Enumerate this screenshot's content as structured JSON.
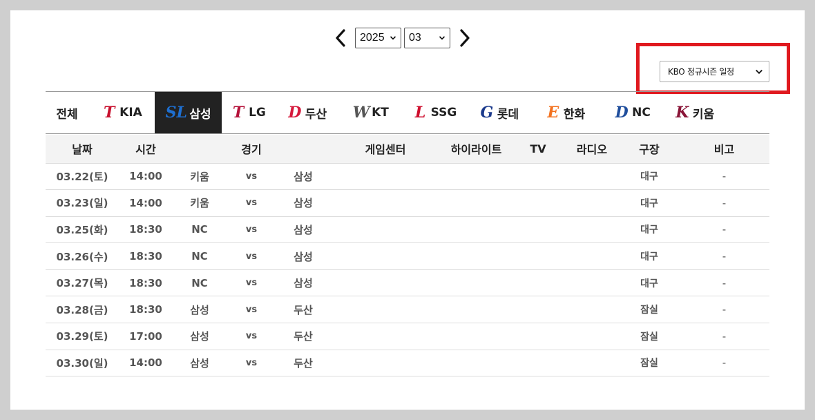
{
  "date_nav": {
    "year": "2025",
    "month": "03"
  },
  "season_select": {
    "value": "KBO 정규시즌 일정"
  },
  "teams": [
    {
      "label": "전체",
      "logo": "",
      "logo_color": "",
      "active": false
    },
    {
      "label": "KIA",
      "logo": "T",
      "logo_color": "#c8102e",
      "active": false
    },
    {
      "label": "삼성",
      "logo": "SL",
      "logo_color": "#1e6fd0",
      "active": true
    },
    {
      "label": "LG",
      "logo": "T",
      "logo_color": "#b5123a",
      "active": false
    },
    {
      "label": "두산",
      "logo": "D",
      "logo_color": "#d61a3c",
      "active": false
    },
    {
      "label": "KT",
      "logo": "W",
      "logo_color": "#555555",
      "active": false
    },
    {
      "label": "SSG",
      "logo": "L",
      "logo_color": "#ce0e2d",
      "active": false
    },
    {
      "label": "롯데",
      "logo": "G",
      "logo_color": "#1b3a8c",
      "active": false
    },
    {
      "label": "한화",
      "logo": "E",
      "logo_color": "#f37321",
      "active": false
    },
    {
      "label": "NC",
      "logo": "D",
      "logo_color": "#1f4e9c",
      "active": false
    },
    {
      "label": "키움",
      "logo": "K",
      "logo_color": "#8a1538",
      "active": false
    }
  ],
  "table": {
    "headers": [
      "날짜",
      "시간",
      "경기",
      "게임센터",
      "하이라이트",
      "TV",
      "라디오",
      "구장",
      "비고"
    ],
    "rows": [
      {
        "date": "03.22(토)",
        "time": "14:00",
        "away": "키움",
        "vs": "vs",
        "home": "삼성",
        "stadium": "대구",
        "note": "-"
      },
      {
        "date": "03.23(일)",
        "time": "14:00",
        "away": "키움",
        "vs": "vs",
        "home": "삼성",
        "stadium": "대구",
        "note": "-"
      },
      {
        "date": "03.25(화)",
        "time": "18:30",
        "away": "NC",
        "vs": "vs",
        "home": "삼성",
        "stadium": "대구",
        "note": "-"
      },
      {
        "date": "03.26(수)",
        "time": "18:30",
        "away": "NC",
        "vs": "vs",
        "home": "삼성",
        "stadium": "대구",
        "note": "-"
      },
      {
        "date": "03.27(목)",
        "time": "18:30",
        "away": "NC",
        "vs": "vs",
        "home": "삼성",
        "stadium": "대구",
        "note": "-"
      },
      {
        "date": "03.28(금)",
        "time": "18:30",
        "away": "삼성",
        "vs": "vs",
        "home": "두산",
        "stadium": "잠실",
        "note": "-"
      },
      {
        "date": "03.29(토)",
        "time": "17:00",
        "away": "삼성",
        "vs": "vs",
        "home": "두산",
        "stadium": "잠실",
        "note": "-"
      },
      {
        "date": "03.30(일)",
        "time": "14:00",
        "away": "삼성",
        "vs": "vs",
        "home": "두산",
        "stadium": "잠실",
        "note": "-"
      }
    ]
  },
  "colors": {
    "highlight_border": "#e0191f",
    "active_tab_bg": "#222222",
    "header_bg": "#f3f3f3"
  }
}
